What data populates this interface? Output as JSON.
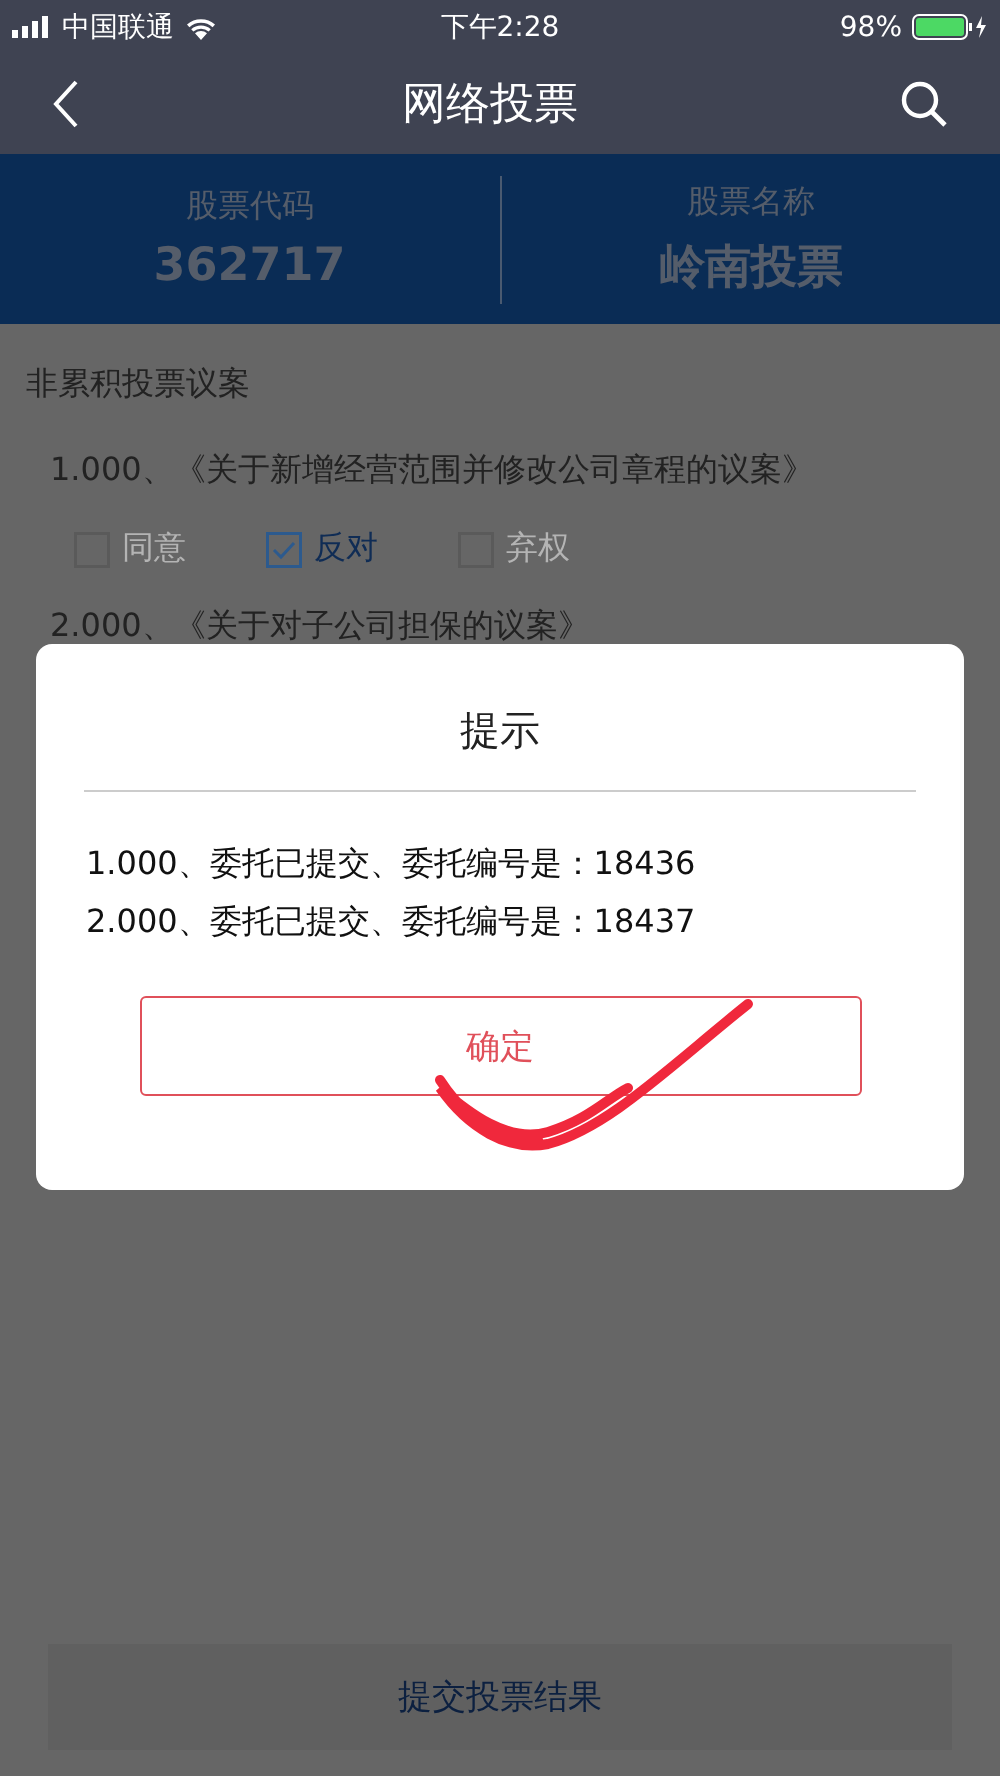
{
  "status_bar": {
    "carrier": "中国联通",
    "time": "下午2:28",
    "battery": "98%"
  },
  "header": {
    "title": "网络投票"
  },
  "stock": [
    {
      "label": "股票代码",
      "value": "362717"
    },
    {
      "label": "股票名称",
      "value": "岭南投票"
    }
  ],
  "section_title": "非累积投票议案",
  "proposals": [
    {
      "title": "1.000、《关于新增经营范围并修改公司章程的议案》",
      "options": [
        {
          "label": "同意",
          "checked": false
        },
        {
          "label": "反对",
          "checked": true
        },
        {
          "label": "弃权",
          "checked": false
        }
      ]
    },
    {
      "title": "2.000、《关于对子公司担保的议案》"
    }
  ],
  "dialog": {
    "title": "提示",
    "lines": [
      "1.000、委托已提交、委托编号是：18436",
      "2.000、委托已提交、委托编号是：18437"
    ],
    "button": "确定"
  },
  "submit_button": "提交投票结果"
}
